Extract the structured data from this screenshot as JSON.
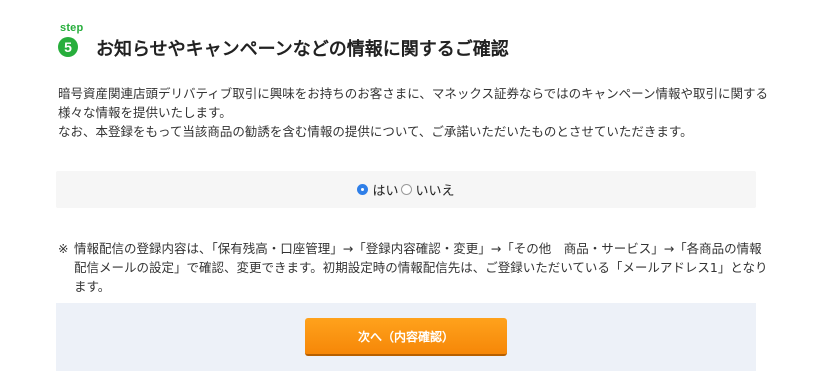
{
  "step": {
    "label": "step",
    "number": "5",
    "color": "#27ae3c"
  },
  "section_title": "お知らせやキャンペーンなどの情報に関するご確認",
  "intro": {
    "paragraph1": "暗号資産関連店頭デリバティブ取引に興味をお持ちのお客さまに、マネックス証券ならではのキャンペーン情報や取引に関する様々な情報を提供いたします。",
    "paragraph2": "なお、本登録をもって当該商品の勧誘を含む情報の提供について、ご承諾いただいたものとさせていただきます。"
  },
  "consent": {
    "options": [
      {
        "label": "はい",
        "checked": true
      },
      {
        "label": "いいえ",
        "checked": false
      }
    ],
    "selected": "はい"
  },
  "note": {
    "mark": "※",
    "text": "情報配信の登録内容は、「保有残高・口座管理」→「登録内容確認・変更」→「その他　商品・サービス」→「各商品の情報配信メールの設定」で確認、変更できます。初期設定時の情報配信先は、ご登録いただいている「メールアドレス1」となります。"
  },
  "submit": {
    "label": "次へ（内容確認）",
    "color": "#f68708"
  }
}
